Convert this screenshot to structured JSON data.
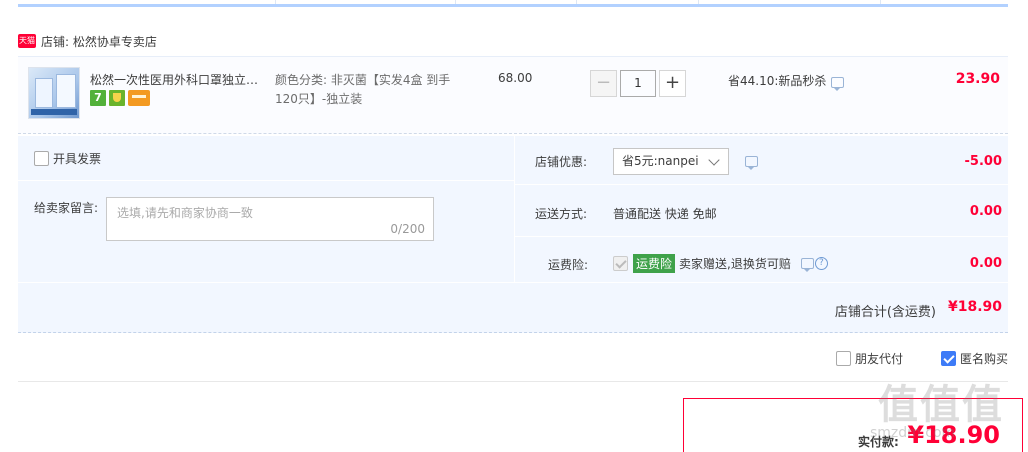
{
  "shop": {
    "badge": "天猫",
    "label": "店铺: 松然协卓专卖店"
  },
  "item": {
    "title": "松然一次性医用外科口罩独立包装成人三层防护透气",
    "icon7": "7",
    "attr_line1": "颜色分类: 非灭菌【实发4盒 到手",
    "attr_line2": "120只】-独立装",
    "unit_price": "68.00",
    "qty_minus": "−",
    "qty_value": "1",
    "qty_plus": "+",
    "promo": "省44.10:新品秒杀",
    "total": "23.90"
  },
  "options": {
    "invoice_label": "开具发票",
    "message_label": "给卖家留言:",
    "message_placeholder": "选填,请先和商家协商一致",
    "message_count": "0/200",
    "shop_discount_label": "店铺优惠:",
    "shop_discount_value": "省5元:nanpei",
    "shop_discount_amount": "-5.00",
    "shipping_label": "运送方式:",
    "shipping_value": "普通配送 快递 免邮",
    "shipping_amount": "0.00",
    "insurance_label": "运费险:",
    "insurance_tag": "运费险",
    "insurance_desc": "卖家赠送,退换货可赔",
    "insurance_help": "?",
    "insurance_amount": "0.00"
  },
  "shop_total": {
    "label": "店铺合计(含运费)",
    "value": "¥18.90"
  },
  "buy": {
    "friend_pay": "朋友代付",
    "anonymous": "匿名购买"
  },
  "payment": {
    "label": "实付款:",
    "value": "¥18.90"
  },
  "watermark": {
    "brand": "值值值",
    "url": "smzdm.com"
  },
  "colors": {
    "accent_red": "#ff0036",
    "accent_blue": "#3d7bf7",
    "panel_bg": "#f2f7ff"
  }
}
